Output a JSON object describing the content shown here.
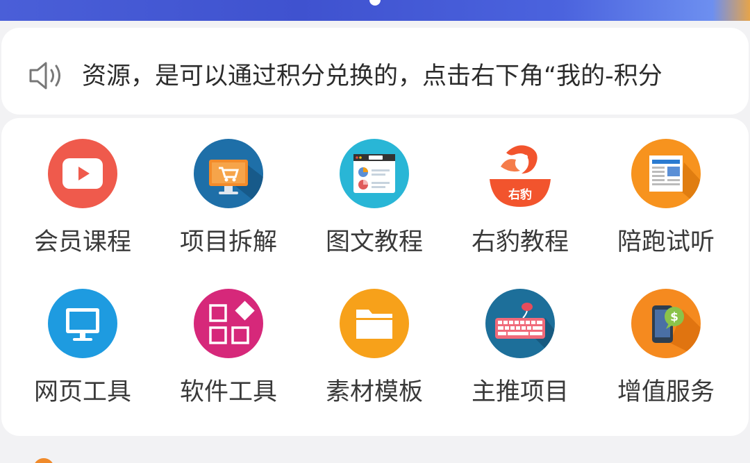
{
  "notice": {
    "text": "资源，是可以通过积分兑换的，点击右下角“我的-积分",
    "icon": "speaker-icon"
  },
  "menu_items": [
    {
      "label": "会员课程",
      "icon": "play-video-icon",
      "color": "#ef5a4c"
    },
    {
      "label": "项目拆解",
      "icon": "monitor-cart-icon",
      "color": "#1e6fa8"
    },
    {
      "label": "图文教程",
      "icon": "browser-document-icon",
      "color": "#29b6d6"
    },
    {
      "label": "右豹教程",
      "icon": "youbao-logo-icon",
      "color": "#f2542d"
    },
    {
      "label": "陪跑试听",
      "icon": "newspaper-icon",
      "color": "#f7931e"
    },
    {
      "label": "网页工具",
      "icon": "desktop-monitor-icon",
      "color": "#1e9be0"
    },
    {
      "label": "软件工具",
      "icon": "app-grid-icon",
      "color": "#d6287a"
    },
    {
      "label": "素材模板",
      "icon": "folder-icon",
      "color": "#f7a11a"
    },
    {
      "label": "主推项目",
      "icon": "keyboard-icon",
      "color": "#1d6f9a"
    },
    {
      "label": "增值服务",
      "icon": "phone-dollar-icon",
      "color": "#f58a1f"
    }
  ]
}
